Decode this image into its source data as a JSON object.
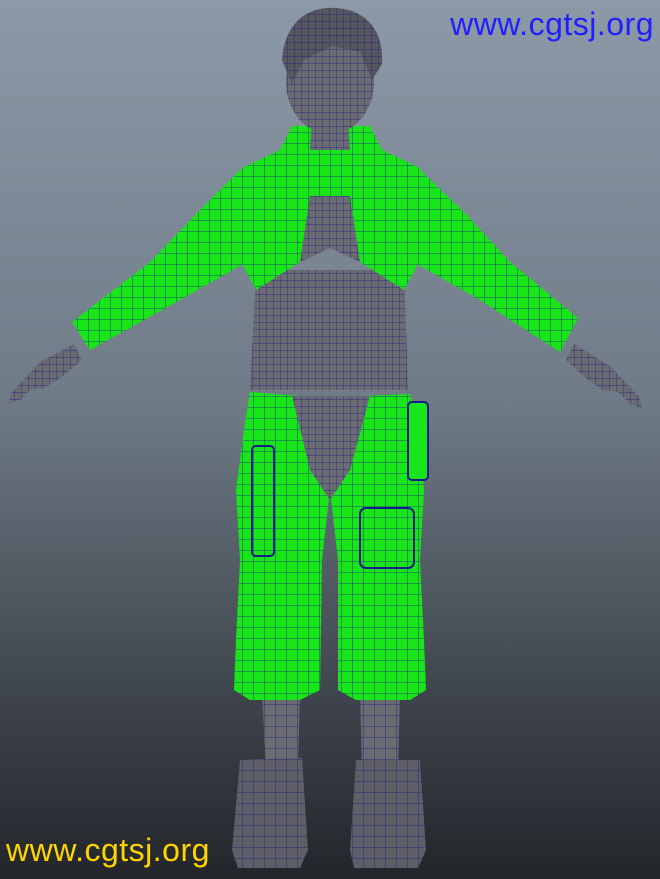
{
  "viewport": {
    "watermark_top": "www.cgtsj.org",
    "watermark_bottom": "www.cgtsj.org"
  },
  "colors": {
    "background_top": "#8c99a6",
    "background_bottom": "#22262a",
    "cloth_fill": "#19e619",
    "skin_fill": "#6b6b72",
    "wireframe": "#1a1a8c",
    "watermark_top": "#1f1fff",
    "watermark_bottom": "#ffd400"
  }
}
